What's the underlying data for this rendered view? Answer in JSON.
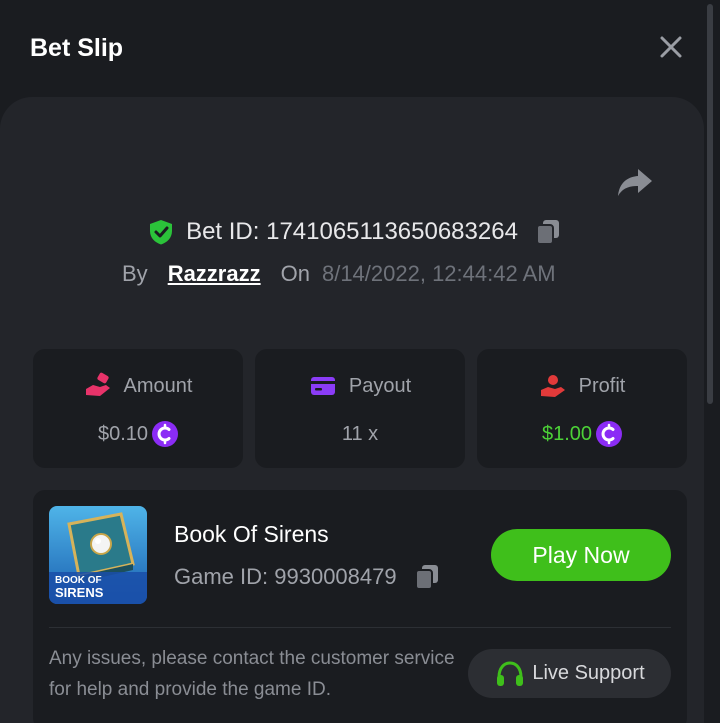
{
  "header": {
    "title": "Bet Slip"
  },
  "bet": {
    "id_label": "Bet ID: 1741065113650683264",
    "by_label": "By",
    "username": "Razzrazz",
    "on_label": "On",
    "datetime": "8/14/2022, 12:44:42 AM"
  },
  "stats": {
    "amount": {
      "label": "Amount",
      "value": "$0.10"
    },
    "payout": {
      "label": "Payout",
      "value": "11 x"
    },
    "profit": {
      "label": "Profit",
      "value": "$1.00"
    }
  },
  "game": {
    "title": "Book Of Sirens",
    "id_label": "Game ID: 9930008479",
    "thumb_text_1": "BOOK OF",
    "thumb_text_2": "SIRENS",
    "play_label": "Play Now"
  },
  "support": {
    "help_text": "Any issues, please contact the customer service for help and provide the game ID.",
    "button_label": "Live Support"
  },
  "colors": {
    "background": "#1a1c20",
    "panel": "#23252a",
    "accent_green": "#3fbf1b",
    "profit_green": "#4cd137",
    "coin_purple": "#8b2cf5",
    "amount_icon": "#e8336a",
    "payout_icon": "#8b3cf7",
    "profit_icon": "#e23a3a"
  },
  "icons": [
    "close-icon",
    "share-icon",
    "shield-check-icon",
    "copy-icon",
    "hand-coin-icon",
    "card-icon",
    "hand-heart-icon",
    "coin-icon",
    "headset-icon"
  ]
}
